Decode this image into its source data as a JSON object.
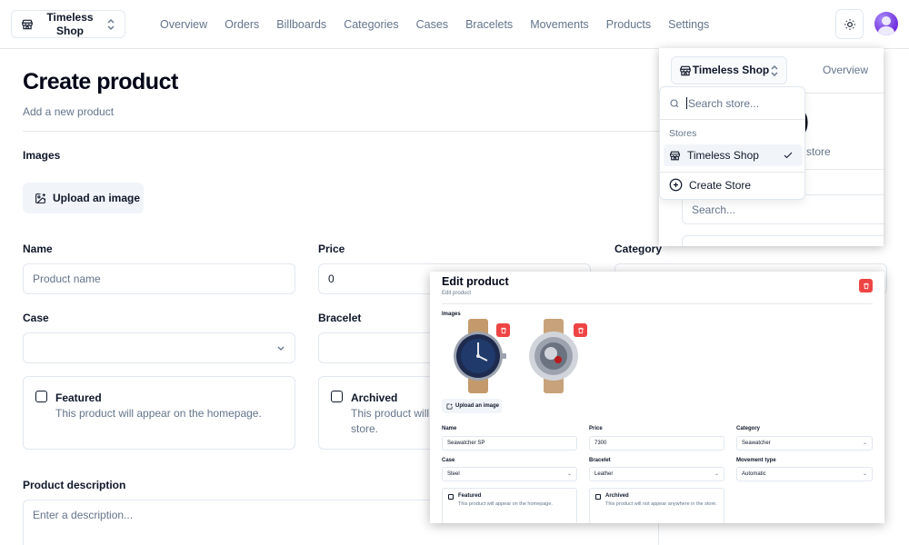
{
  "topbar": {
    "store_name": "Timeless Shop",
    "nav": [
      "Overview",
      "Orders",
      "Billboards",
      "Categories",
      "Cases",
      "Bracelets",
      "Movements",
      "Products",
      "Settings"
    ]
  },
  "create_form": {
    "title": "Create product",
    "subtitle": "Add a new product",
    "images_label": "Images",
    "upload_label": "Upload an image",
    "name_label": "Name",
    "name_placeholder": "Product name",
    "price_label": "Price",
    "price_value": "0",
    "category_label": "Category",
    "case_label": "Case",
    "case_value": "",
    "bracelet_label": "Bracelet",
    "featured_title": "Featured",
    "featured_desc": "This product will appear on the homepage.",
    "archived_title": "Archived",
    "archived_desc_1": "This product will",
    "archived_desc_2": "store.",
    "description_label": "Product description",
    "description_placeholder": "Enter a description..."
  },
  "store_window": {
    "store_name": "Timeless Shop",
    "nav_overview": "Overview",
    "background_heading": "y)",
    "background_sub": "ur store",
    "background_search": "Search...",
    "popover": {
      "search_placeholder": "Search store...",
      "group_label": "Stores",
      "items": [
        "Timeless Shop"
      ],
      "create_label": "Create Store"
    }
  },
  "edit_window": {
    "title": "Edit product",
    "subtitle": "Edit product",
    "images_label": "Images",
    "upload_label": "Upload an image",
    "name_label": "Name",
    "name_value": "Seawatcher SP",
    "price_label": "Price",
    "price_value": "7300",
    "category_label": "Category",
    "category_value": "Seawatcher",
    "case_label": "Case",
    "case_value": "Steel",
    "bracelet_label": "Bracelet",
    "bracelet_value": "Leather",
    "movement_label": "Movement type",
    "movement_value": "Automatic",
    "featured_title": "Featured",
    "featured_desc": "This product will appear on the homepage.",
    "archived_title": "Archived",
    "archived_desc": "This product will not appear anywhere in the store."
  },
  "colors": {
    "danger": "#ef4444",
    "muted_bg": "#f1f5f9",
    "border": "#e2e8f0",
    "avatar": "#7c3aed"
  },
  "icons": [
    "store-icon",
    "chevrons-up-down-icon",
    "sun-icon",
    "image-plus-icon",
    "chevron-down-icon",
    "search-icon",
    "check-icon",
    "plus-circle-icon",
    "trash-icon"
  ]
}
